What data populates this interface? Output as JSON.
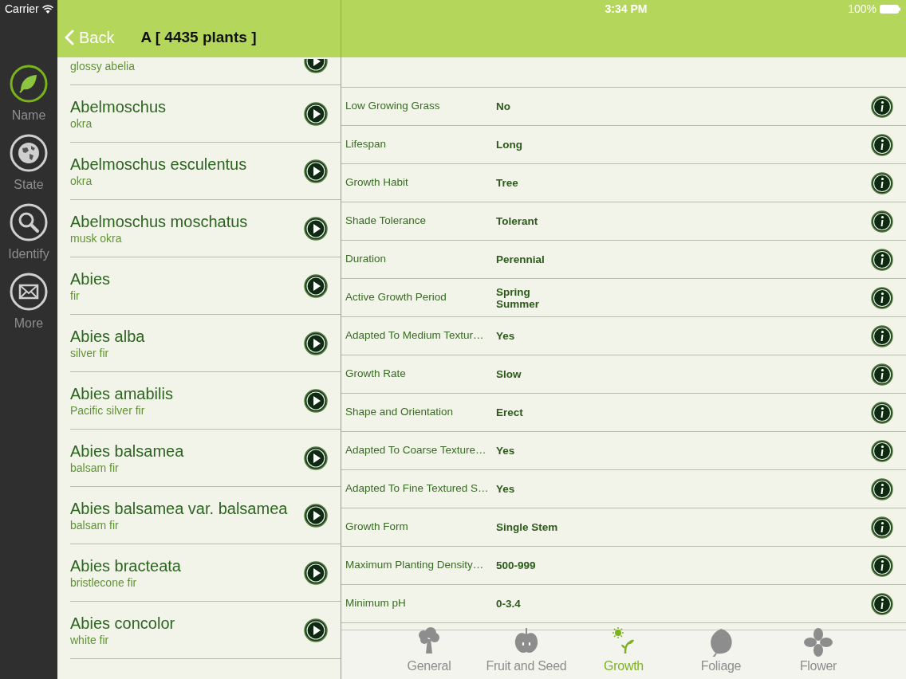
{
  "status_bar": {
    "carrier": "Carrier",
    "time": "3:34 PM",
    "battery": "100%"
  },
  "sidebar": {
    "items": [
      {
        "label": "Name",
        "selected": true
      },
      {
        "label": "State",
        "selected": false
      },
      {
        "label": "Identify",
        "selected": false
      },
      {
        "label": "More",
        "selected": false
      }
    ]
  },
  "list_header": {
    "back": "Back",
    "title": "A [ 4435 plants ]"
  },
  "plants": [
    {
      "kind": "partial",
      "common": "glossy abelia"
    },
    {
      "kind": "full",
      "name": "Abelmoschus",
      "common": "okra"
    },
    {
      "kind": "full",
      "name": "Abelmoschus esculentus",
      "common": "okra"
    },
    {
      "kind": "full",
      "name": "Abelmoschus moschatus",
      "common": "musk okra"
    },
    {
      "kind": "full",
      "name": "Abies",
      "common": "fir"
    },
    {
      "kind": "full",
      "name": "Abies alba",
      "common": "silver fir"
    },
    {
      "kind": "full",
      "name": "Abies amabilis",
      "common": "Pacific silver fir"
    },
    {
      "kind": "full",
      "name": "Abies balsamea",
      "common": "balsam fir"
    },
    {
      "kind": "full",
      "name": "Abies balsamea var. balsamea",
      "common": "balsam fir"
    },
    {
      "kind": "full",
      "name": "Abies bracteata",
      "common": "bristlecone fir"
    },
    {
      "kind": "full",
      "name": "Abies concolor",
      "common": "white fir"
    }
  ],
  "details": [
    {
      "label": "Low Growing Grass",
      "values": [
        "No"
      ]
    },
    {
      "label": "Lifespan",
      "values": [
        "Long"
      ]
    },
    {
      "label": "Growth Habit",
      "values": [
        "Tree"
      ]
    },
    {
      "label": "Shade Tolerance",
      "values": [
        "Tolerant"
      ]
    },
    {
      "label": "Duration",
      "values": [
        "Perennial"
      ]
    },
    {
      "label": "Active Growth Period",
      "values": [
        "Spring",
        "Summer"
      ]
    },
    {
      "label": "Adapted To Medium Textur…",
      "values": [
        "Yes"
      ]
    },
    {
      "label": "Growth Rate",
      "values": [
        "Slow"
      ]
    },
    {
      "label": "Shape and Orientation",
      "values": [
        "Erect"
      ]
    },
    {
      "label": "Adapted To Coarse Texture…",
      "values": [
        "Yes"
      ]
    },
    {
      "label": "Adapted To Fine Textured S…",
      "values": [
        "Yes"
      ]
    },
    {
      "label": "Growth Form",
      "values": [
        "Single Stem"
      ]
    },
    {
      "label": "Maximum Planting Density…",
      "values": [
        "500-999"
      ]
    },
    {
      "label": "Minimum pH",
      "values": [
        "0-3.4"
      ]
    }
  ],
  "tabs": [
    {
      "label": "General",
      "selected": false
    },
    {
      "label": "Fruit and Seed",
      "selected": false
    },
    {
      "label": "Growth",
      "selected": true
    },
    {
      "label": "Foliage",
      "selected": false
    },
    {
      "label": "Flower",
      "selected": false
    }
  ]
}
